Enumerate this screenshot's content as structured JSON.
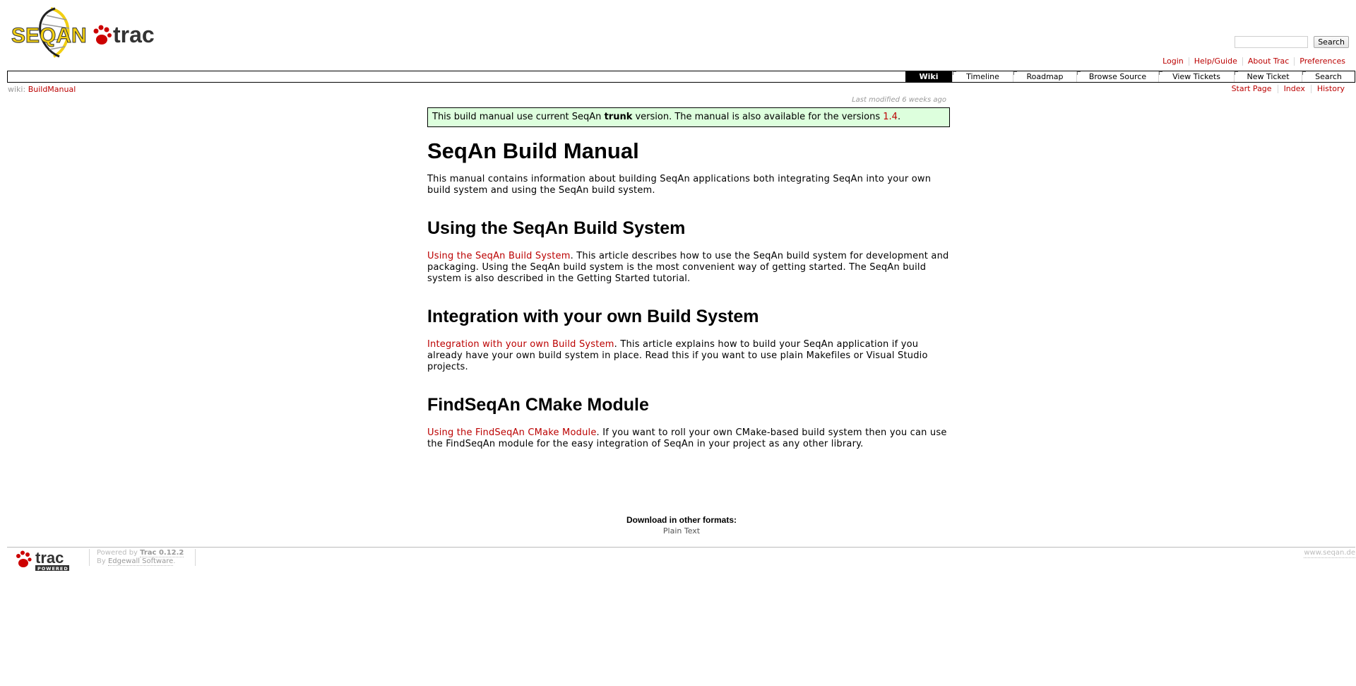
{
  "logo": {
    "seqan_text": "SEQAN",
    "trac_text": "trac"
  },
  "search": {
    "placeholder": "",
    "button_label": "Search"
  },
  "metanav": [
    "Login",
    "Help/Guide",
    "About Trac",
    "Preferences"
  ],
  "mainnav": [
    {
      "label": "Wiki",
      "active": true
    },
    {
      "label": "Timeline",
      "active": false
    },
    {
      "label": "Roadmap",
      "active": false
    },
    {
      "label": "Browse Source",
      "active": false
    },
    {
      "label": "View Tickets",
      "active": false
    },
    {
      "label": "New Ticket",
      "active": false
    },
    {
      "label": "Search",
      "active": false
    }
  ],
  "pagepath": {
    "prefix": "wiki:",
    "page": "BuildManual"
  },
  "ctxtnav": [
    "Start Page",
    "Index",
    "History"
  ],
  "last_modified": "Last modified 6 weeks ago",
  "notice": {
    "before": "This build manual use current SeqAn ",
    "bold": "trunk",
    "middle": " version. The manual is also available for the versions ",
    "link": "1.4",
    "after": "."
  },
  "page_title": "SeqAn Build Manual",
  "intro": "This manual contains information about building SeqAn applications both integrating SeqAn into your own build system and using the SeqAn build system.",
  "sections": [
    {
      "heading": "Using the SeqAn Build System",
      "link": "Using the SeqAn Build System",
      "text": ". This article describes how to use the SeqAn build system for development and packaging. Using the SeqAn build system is the most convenient way of getting started. The SeqAn build system is also described in the Getting Started tutorial."
    },
    {
      "heading": "Integration with your own Build System",
      "link": "Integration with your own Build System",
      "text": ". This article explains how to build your SeqAn application if you already have your own build system in place. Read this if you want to use plain Makefiles or Visual Studio projects."
    },
    {
      "heading": "FindSeqAn CMake Module",
      "link": "Using the FindSeqAn CMake Module",
      "text": ". If you want to roll your own CMake-based build system then you can use the FindSeqAn module for the easy integration of SeqAn in your project as any other library."
    }
  ],
  "altlinks": {
    "heading": "Download in other formats:",
    "plain_text": "Plain Text"
  },
  "footer": {
    "powered_prefix": "Powered by ",
    "trac_version": "Trac 0.12.2",
    "by_prefix": "By ",
    "edgewall": "Edgewall Software",
    "by_suffix": ".",
    "site": "www.seqan.de",
    "badge_trac": "trac",
    "badge_powered": "POWERED"
  },
  "colors": {
    "link": "#bb0000",
    "notice_bg": "#ddffdd",
    "logo_yellow": "#f2cf12"
  }
}
